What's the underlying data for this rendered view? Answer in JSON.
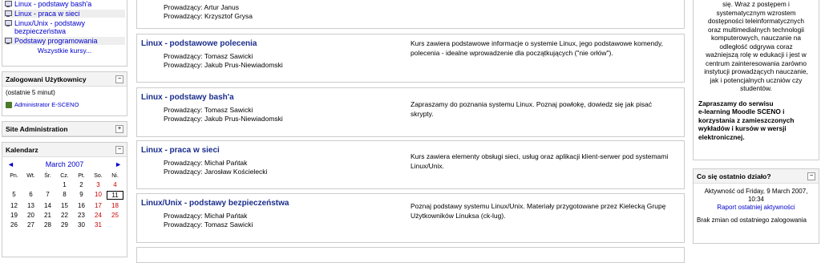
{
  "left": {
    "courses": [
      {
        "label": "Linux - podstawy bash'a"
      },
      {
        "label": "Linux - praca w sieci"
      },
      {
        "label": "Linux/Unix - podstawy bezpieczeństwa"
      },
      {
        "label": "Podstawy programowania"
      }
    ],
    "all_courses": "Wszystkie kursy...",
    "online": {
      "title": "Zalogowani Użytkownicy",
      "period": "(ostatnie 5 minut)",
      "user": "Administrator E-SCENO"
    },
    "site_admin": {
      "title": "Site Administration"
    },
    "calendar": {
      "title": "Kalendarz",
      "month": "March 2007",
      "prev": "◄",
      "next": "►",
      "days": [
        "Pn.",
        "Wt.",
        "Śr.",
        "Cz.",
        "Pt.",
        "So.",
        "Ni."
      ],
      "weeks": [
        [
          "",
          "",
          "",
          "1",
          "2",
          "3",
          "4"
        ],
        [
          "5",
          "6",
          "7",
          "8",
          "9",
          "10",
          "11"
        ],
        [
          "12",
          "13",
          "14",
          "15",
          "16",
          "17",
          "18"
        ],
        [
          "19",
          "20",
          "21",
          "22",
          "23",
          "24",
          "25"
        ],
        [
          "26",
          "27",
          "28",
          "29",
          "30",
          "31",
          ""
        ]
      ],
      "today": "11"
    }
  },
  "center": {
    "top_teachers": [
      "Prowadzący: Artur Janus",
      "Prowadzący: Krzysztof Grysa"
    ],
    "courses": [
      {
        "title": "Linux - podstawowe polecenia",
        "teachers": [
          "Prowadzący: Tomasz Sawicki",
          "Prowadzący: Jakub Prus-Niewiadomski"
        ],
        "summary": "Kurs zawiera podstawowe informacje o systemie Linux, jego podstawowe komendy, polecenia - idealne wprowadzenie dla początkujących (\"nie orłów\")."
      },
      {
        "title": "Linux - podstawy bash'a",
        "teachers": [
          "Prowadzący: Tomasz Sawicki",
          "Prowadzący: Jakub Prus-Niewiadomski"
        ],
        "summary": "Zapraszamy do poznania systemu Linux. Poznaj powłokę, dowiedz się jak pisać skrypty."
      },
      {
        "title": "Linux - praca w sieci",
        "teachers": [
          "Prowadzący: Michał Pańtak",
          "Prowadzący: Jarosław Kościelecki"
        ],
        "summary": "Kurs zawiera elementy obsługi sieci, usług oraz aplikacji klient-serwer pod systemami Linux/Unix."
      },
      {
        "title": "Linux/Unix - podstawy bezpieczeństwa",
        "teachers": [
          "Prowadzący: Michał Pańtak",
          "Prowadzący: Tomasz Sawicki"
        ],
        "summary": "Poznaj podstawy systemu Linux/Unix. Materiały przygotowane przez Kielecką Grupę Użytkowników Linuksa (ck-lug)."
      }
    ]
  },
  "right": {
    "intro_lines": [
      "się. Wraz z postępem i",
      "systematycznym wzrostem",
      "dostępności teleinformatycznych",
      "oraz multimedialnych technologii",
      "komputerowych, nauczanie na",
      "odległość odgrywa coraz",
      "ważniejszą rolę w edukacji i jest w",
      "centrum zainteresowania zarówno",
      "instytucji prowadzących nauczanie,",
      "jak i potencjalnych uczniów czy",
      "studentów."
    ],
    "invite": [
      "Zapraszamy do serwisu",
      "e-learning Moodle SCENO i",
      "korzystania z zamieszczonych",
      "wykładów i kursów w wersji",
      "elektronicznej."
    ],
    "recent": {
      "title": "Co się ostatnio działo?",
      "activity": "Aktywność od Friday, 9 March 2007, 10:34",
      "report": "Raport ostatniej aktywności",
      "no_changes": "Brak zmian od ostatniego zalogowania"
    }
  }
}
